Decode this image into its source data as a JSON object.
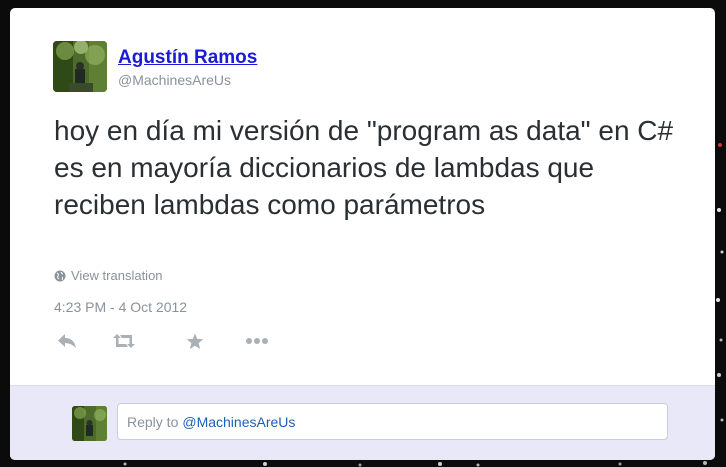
{
  "author": {
    "name": "Agustín Ramos",
    "handle": "@MachinesAreUs"
  },
  "tweet": {
    "text": "hoy en día mi versión de \"program as data\" en C# es en mayoría diccionarios de lambdas que reciben lambdas como parámetros",
    "translate_label": "View translation",
    "timestamp": "4:23 PM - 4 Oct 2012"
  },
  "actions": [
    {
      "name": "reply",
      "icon": "reply-icon"
    },
    {
      "name": "retweet",
      "icon": "retweet-icon"
    },
    {
      "name": "favorite",
      "icon": "star-icon"
    },
    {
      "name": "more",
      "icon": "more-icon"
    }
  ],
  "reply_box": {
    "prefix": "Reply to",
    "mention": "@MachinesAreUs"
  },
  "colors": {
    "name_link": "#1b1bd6",
    "muted_text": "#8a929a",
    "tweet_text": "#292f33",
    "reply_bar_bg": "#e8e8f8",
    "icon_gray": "#a9b0b6"
  }
}
